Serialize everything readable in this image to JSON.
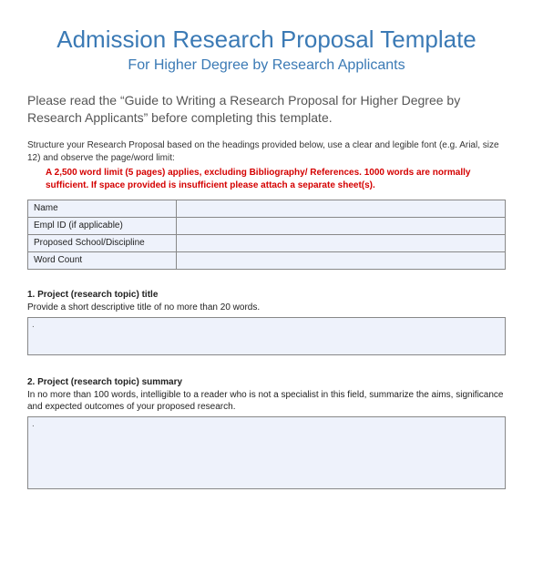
{
  "header": {
    "title": "Admission Research Proposal Template",
    "subtitle": "For Higher Degree by Research Applicants"
  },
  "intro": "Please read the “Guide to Writing a Research Proposal for Higher Degree by Research Applicants” before completing this template.",
  "structure_note": "Structure your Research Proposal based on the headings provided below, use a clear and legible font (e.g. Arial, size 12) and observe the page/word limit:",
  "word_limit": "A 2,500 word limit (5 pages) applies, excluding Bibliography/ References. 1000 words are normally sufficient. If space provided is insufficient please attach a separate sheet(s).",
  "info_table": {
    "rows": [
      {
        "label": "Name",
        "value": ""
      },
      {
        "label": "Empl ID (if applicable)",
        "value": ""
      },
      {
        "label": "Proposed School/Discipline",
        "value": ""
      },
      {
        "label": "Word Count",
        "value": ""
      }
    ]
  },
  "sections": [
    {
      "heading": "1.    Project (research topic) title",
      "desc": "Provide a short descriptive title of no more than 20 words.",
      "placeholder": "."
    },
    {
      "heading": "2.    Project (research topic) summary",
      "desc": "In no more than 100 words, intelligible to a reader who is not a specialist in this field, summarize the aims, significance and expected outcomes of your proposed research.",
      "placeholder": "."
    }
  ]
}
